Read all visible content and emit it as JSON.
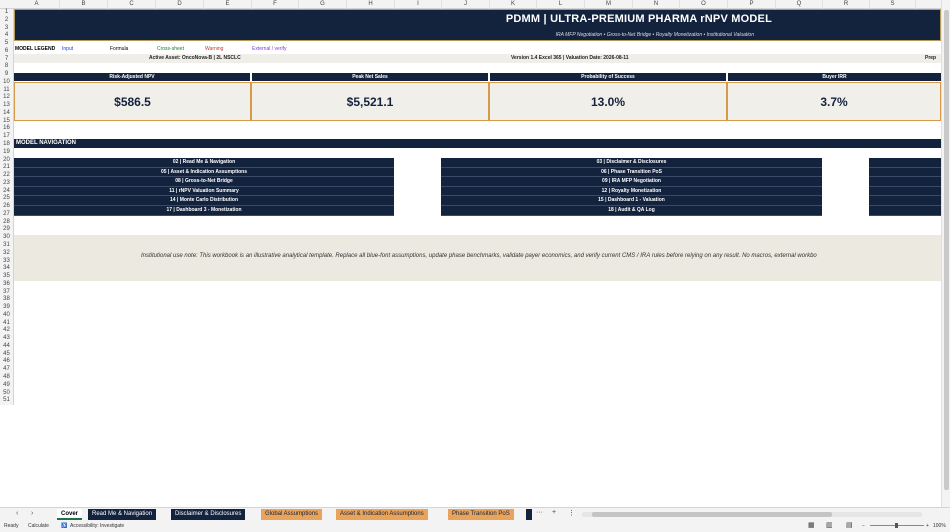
{
  "columns": [
    "A",
    "B",
    "C",
    "D",
    "E",
    "F",
    "G",
    "H",
    "I",
    "J",
    "K",
    "L",
    "M",
    "N",
    "O",
    "P",
    "Q",
    "R",
    "S"
  ],
  "rows": [
    "1",
    "2",
    "3",
    "4",
    "5",
    "6",
    "7",
    "8",
    "9",
    "10",
    "11",
    "12",
    "13",
    "14",
    "15",
    "16",
    "17",
    "18",
    "19",
    "20",
    "21",
    "22",
    "23",
    "24",
    "25",
    "26",
    "27",
    "28",
    "29",
    "30",
    "31",
    "32",
    "33",
    "34",
    "35",
    "36",
    "37",
    "38",
    "39",
    "40",
    "41",
    "42",
    "43",
    "44",
    "45",
    "46",
    "47",
    "48",
    "49",
    "50",
    "51"
  ],
  "header": {
    "title": "PDMM | ULTRA-PREMIUM PHARMA rNPV MODEL",
    "subtitle": "IRA MFP Negotiation • Gross-to-Net Bridge • Royalty Monetization • Institutional Valuation"
  },
  "legend": {
    "label": "MODEL LEGEND",
    "input": "Input",
    "formula": "Formula",
    "cross_sheet": "Cross-sheet",
    "warning": "Warning",
    "external": "External / verify",
    "colors": {
      "input": "#1f3fd6",
      "formula": "#000000",
      "cross_sheet": "#1e7a2e",
      "warning": "#c0392b",
      "external": "#7b3fd6"
    }
  },
  "meta": {
    "active_asset": "Active Asset: OncoNova-B | 2L NSCLC",
    "version": "Version 1.4 Excel 365 | Valuation Date: 2026-08-11",
    "prep": "Prep"
  },
  "kpis": [
    {
      "label": "Risk-Adjusted NPV",
      "value": "$586.5"
    },
    {
      "label": "Peak Net Sales",
      "value": "$5,521.1"
    },
    {
      "label": "Probability of Success",
      "value": "13.0%"
    },
    {
      "label": "Buyer IRR",
      "value": "3.7%"
    }
  ],
  "nav": {
    "heading": "MODEL NAVIGATION",
    "col1": [
      "02 | Read Me & Navigation",
      "05 | Asset & Indication Assumptions",
      "08 | Gross-to-Net Bridge",
      "11 | rNPV Valuation Summary",
      "14 | Monte Carlo Distribution",
      "17 | Dashboard 3 - Monetization"
    ],
    "col2": [
      "03 | Disclaimer & Disclosures",
      "06 | Phase Transition PoS",
      "09 | IRA MFP Negotiation",
      "12 | Royalty Monetization",
      "15 | Dashboard 1 - Valuation",
      "18 | Audit & QA Log"
    ]
  },
  "note": "Institutional use note: This workbook is an illustrative analytical template. Replace all blue-font assumptions, update phase benchmarks, validate payer economics, and verify current CMS / IRA rules before relying on any result. No macros, external workbo",
  "tabs": [
    {
      "label": "Cover",
      "style": "active"
    },
    {
      "label": "Read Me & Navigation",
      "style": "dark"
    },
    {
      "label": "Disclaimer & Disclosures",
      "style": "dark"
    },
    {
      "label": "Global Assumptions",
      "style": "orange"
    },
    {
      "label": "Asset & Indication Assumptions",
      "style": "orange"
    },
    {
      "label": "Phase Transition PoS",
      "style": "orange"
    }
  ],
  "tab_tools": {
    "more": "···",
    "add": "+",
    "menu": "⋮"
  },
  "status": {
    "ready": "Ready",
    "calculate": "Calculate",
    "accessibility": "Accessibility: Investigate",
    "zoom": "100%"
  }
}
